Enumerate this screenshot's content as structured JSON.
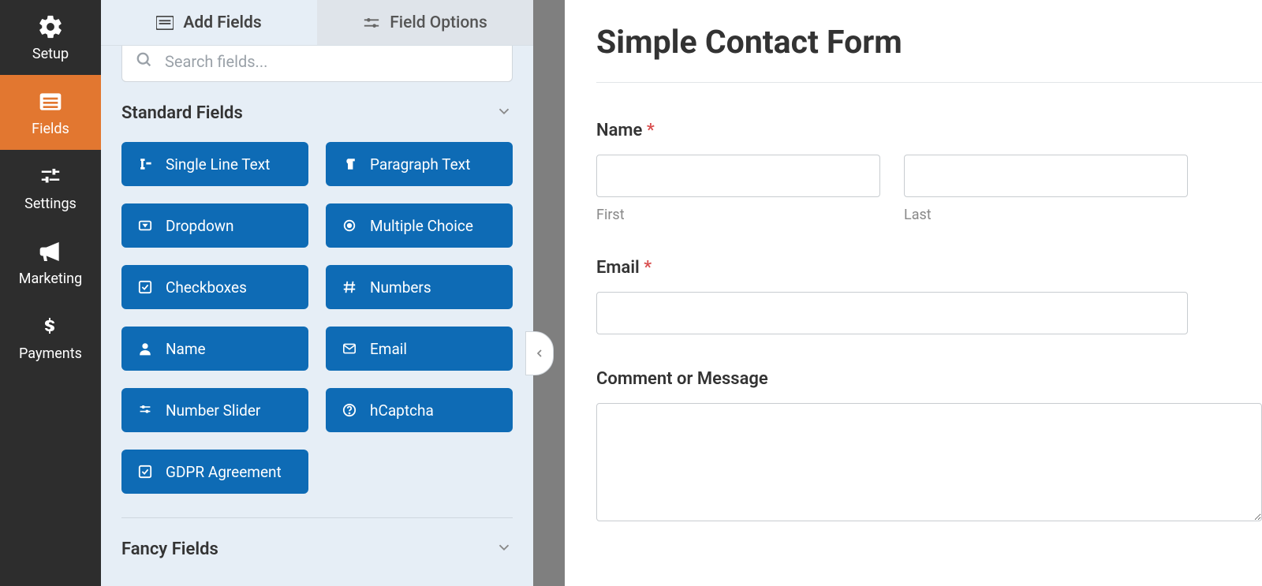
{
  "nav": {
    "setup": "Setup",
    "fields": "Fields",
    "settings": "Settings",
    "marketing": "Marketing",
    "payments": "Payments"
  },
  "tabs": {
    "add_fields": "Add Fields",
    "field_options": "Field Options"
  },
  "search": {
    "placeholder": "Search fields..."
  },
  "sections": {
    "standard": "Standard Fields",
    "fancy": "Fancy Fields"
  },
  "fields": {
    "single_line_text": "Single Line Text",
    "paragraph_text": "Paragraph Text",
    "dropdown": "Dropdown",
    "multiple_choice": "Multiple Choice",
    "checkboxes": "Checkboxes",
    "numbers": "Numbers",
    "name": "Name",
    "email": "Email",
    "number_slider": "Number Slider",
    "hcaptcha": "hCaptcha",
    "gdpr": "GDPR Agreement"
  },
  "preview": {
    "title": "Simple Contact Form",
    "name_label": "Name",
    "first_sub": "First",
    "last_sub": "Last",
    "email_label": "Email",
    "comment_label": "Comment or Message"
  }
}
